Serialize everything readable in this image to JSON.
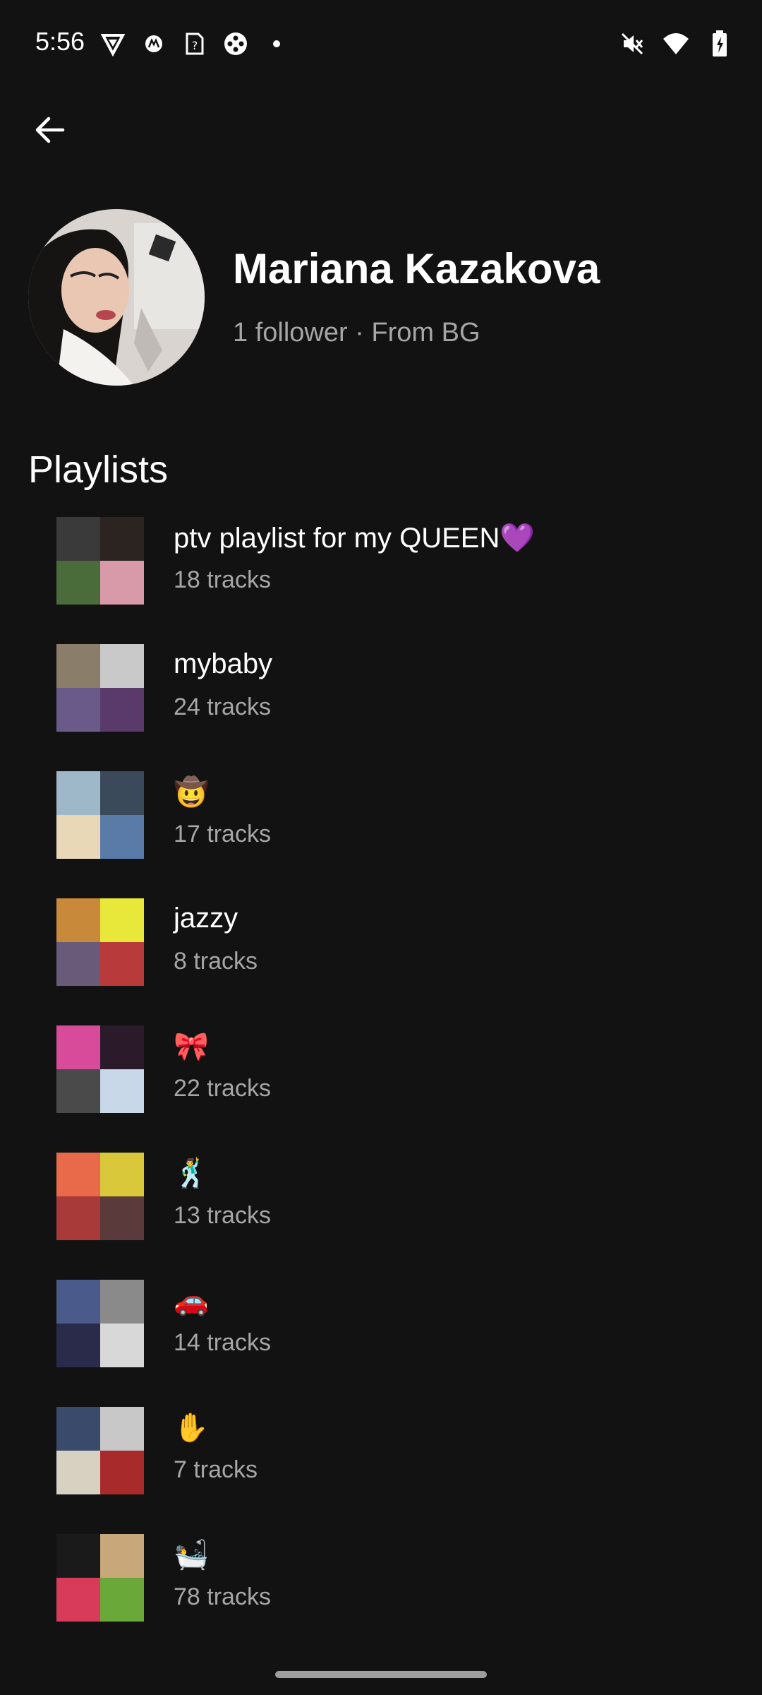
{
  "status_bar": {
    "time": "5:56",
    "left_icons": [
      "vpn-shield-icon",
      "motorola-icon",
      "sim-unknown-icon",
      "game-controller-icon",
      "dot-icon"
    ],
    "right_icons": [
      "mute-icon",
      "wifi-icon",
      "battery-charging-icon"
    ]
  },
  "profile": {
    "name": "Mariana Kazakova",
    "meta": "1 follower · From BG"
  },
  "section": {
    "title": "Playlists"
  },
  "playlists": [
    {
      "name": "ptv playlist for my QUEEN💜",
      "tracks": "18 tracks",
      "cover_colors": [
        "#3a3a3a",
        "#2b2420",
        "#4a6b3a",
        "#d89aa8"
      ]
    },
    {
      "name": "mybaby",
      "tracks": "24 tracks",
      "cover_colors": [
        "#8a7d6a",
        "#c9c9c9",
        "#6a5a8a",
        "#5a3a6a"
      ]
    },
    {
      "name": "🤠",
      "tracks": "17 tracks",
      "cover_colors": [
        "#9fb8c9",
        "#3a4a5a",
        "#e8d8b8",
        "#5a7aa8"
      ]
    },
    {
      "name": "jazzy",
      "tracks": "8 tracks",
      "cover_colors": [
        "#c88a3a",
        "#e8e83a",
        "#6a5a7a",
        "#b83a3a"
      ]
    },
    {
      "name": "🎀",
      "tracks": "22 tracks",
      "cover_colors": [
        "#d84a9a",
        "#2a1a2a",
        "#4a4a4a",
        "#c8d8e8"
      ]
    },
    {
      "name": "🕺",
      "tracks": "13 tracks",
      "cover_colors": [
        "#e86a4a",
        "#d8c83a",
        "#a83a3a",
        "#5a3a3a"
      ]
    },
    {
      "name": "🚗",
      "tracks": "14 tracks",
      "cover_colors": [
        "#4a5a8a",
        "#8a8a8a",
        "#2a2a4a",
        "#d8d8d8"
      ]
    },
    {
      "name": "✋",
      "tracks": "7 tracks",
      "cover_colors": [
        "#3a4a6a",
        "#c8c8c8",
        "#d8d0c0",
        "#a82a2a"
      ]
    },
    {
      "name": "🛀",
      "tracks": "78 tracks",
      "cover_colors": [
        "#1a1a1a",
        "#c8a87a",
        "#d83a5a",
        "#6aa83a"
      ]
    }
  ]
}
